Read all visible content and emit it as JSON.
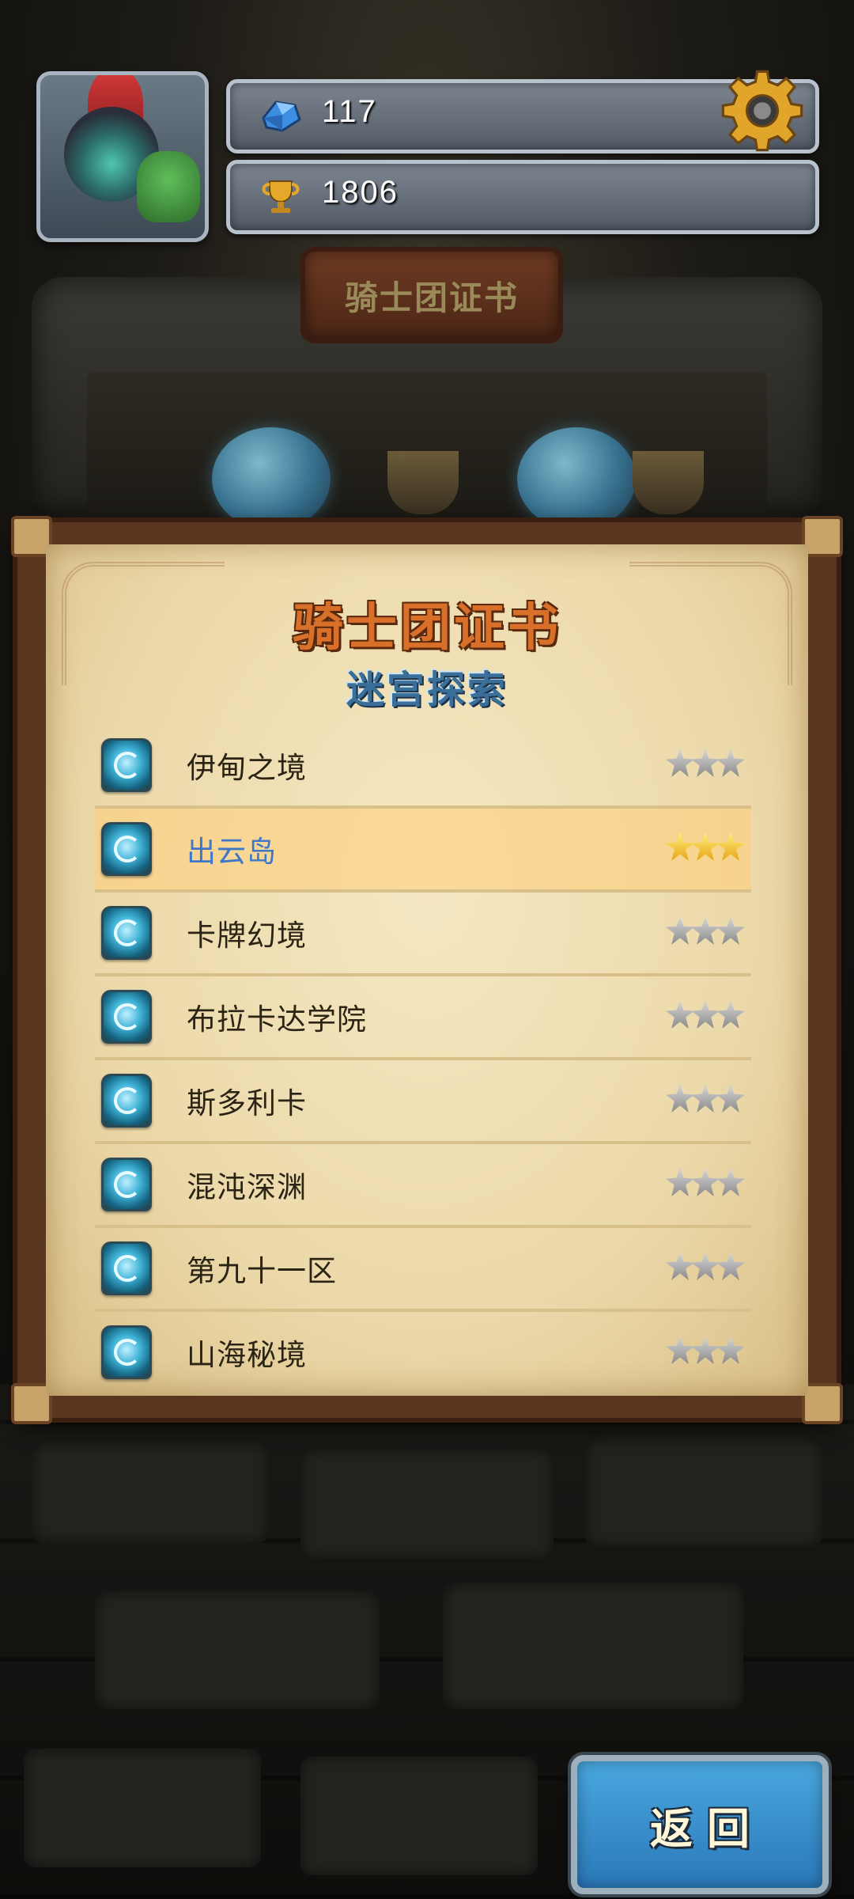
{
  "hud": {
    "gems": "117",
    "trophies": "1806"
  },
  "banner": {
    "title": "骑士团证书"
  },
  "panel": {
    "title": "骑士团证书",
    "subtitle": "迷宫探索",
    "items": [
      {
        "name": "伊甸之境",
        "stars_earned": 0,
        "stars_total": 3
      },
      {
        "name": "出云岛",
        "stars_earned": 3,
        "stars_total": 3
      },
      {
        "name": "卡牌幻境",
        "stars_earned": 0,
        "stars_total": 3
      },
      {
        "name": "布拉卡达学院",
        "stars_earned": 0,
        "stars_total": 3
      },
      {
        "name": "斯多利卡",
        "stars_earned": 0,
        "stars_total": 3
      },
      {
        "name": "混沌深渊",
        "stars_earned": 0,
        "stars_total": 3
      },
      {
        "name": "第九十一区",
        "stars_earned": 0,
        "stars_total": 3
      },
      {
        "name": "山海秘境",
        "stars_earned": 0,
        "stars_total": 3
      }
    ],
    "selected_index": 1
  },
  "back_button": {
    "label": "返回"
  },
  "colors": {
    "selected_text": "#3f78c8",
    "title": "#d9702a",
    "subtitle": "#3a6f9a",
    "button": "#2a78b8"
  },
  "icons": {
    "gems": "blue-gem-icon",
    "trophies": "gold-trophy-icon",
    "settings": "gear-icon",
    "list_item": "portal-icon",
    "rating": "star-icon"
  }
}
